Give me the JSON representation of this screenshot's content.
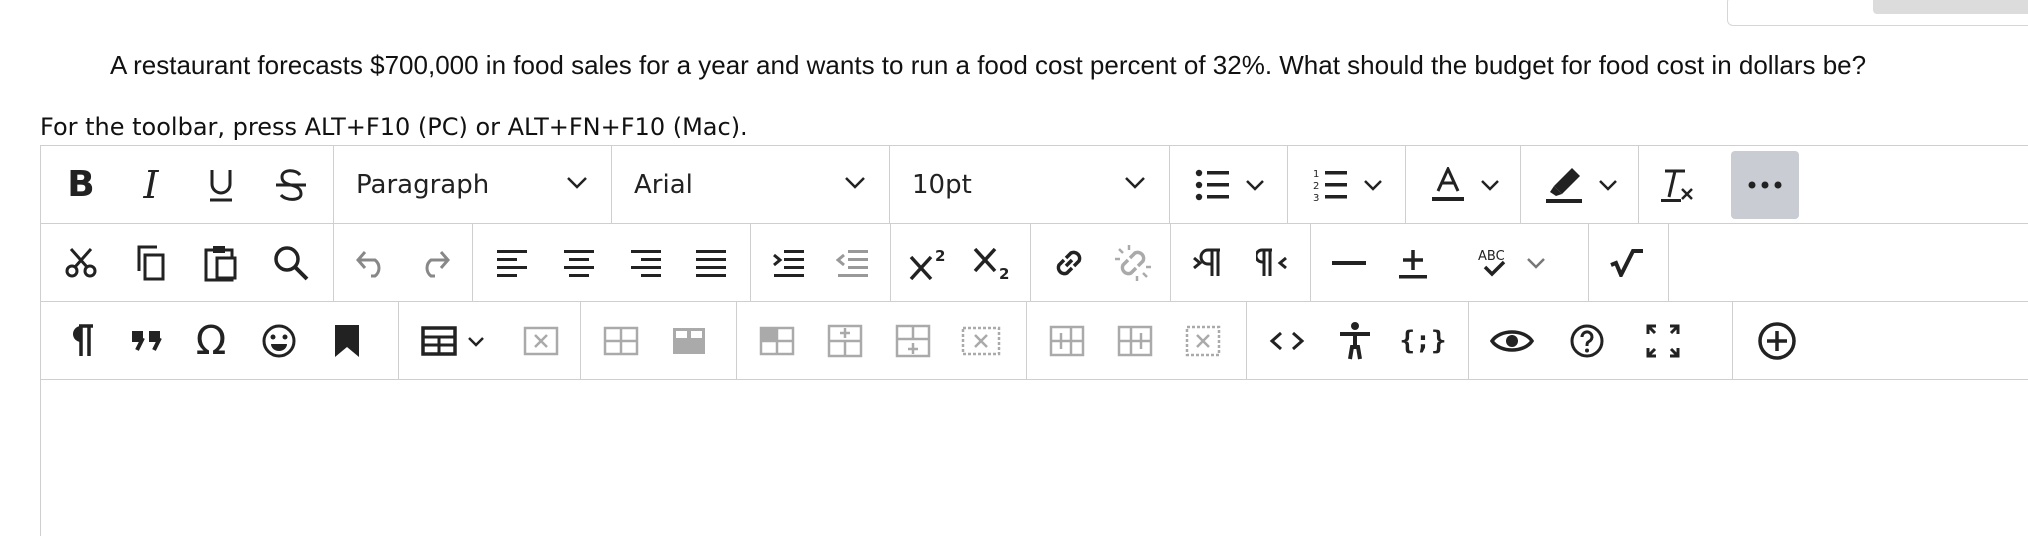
{
  "question": {
    "text": "A restaurant forecasts $700,000 in food sales for a year and wants to run a food cost percent of 32%. What should the budget for food cost in dollars be?"
  },
  "editor": {
    "hint": "For the toolbar, press ALT+F10 (PC) or ALT+FN+F10 (Mac).",
    "block_format": "Paragraph",
    "font_family": "Arial",
    "font_size": "10pt",
    "body_text": "",
    "toolbar": {
      "row1": [
        "bold-icon",
        "italic-icon",
        "underline-icon",
        "strikethrough-icon",
        "bullet-list-icon",
        "numbered-list-icon",
        "text-color-icon",
        "highlight-icon",
        "clear-formatting-icon",
        "more-icon"
      ],
      "row2": [
        "cut-icon",
        "copy-icon",
        "paste-icon",
        "find-icon",
        "undo-icon",
        "redo-icon",
        "align-left-icon",
        "align-center-icon",
        "align-right-icon",
        "justify-icon",
        "indent-icon",
        "outdent-icon",
        "superscript-icon",
        "subscript-icon",
        "link-icon",
        "unlink-icon",
        "ltr-icon",
        "rtl-icon",
        "horizontal-rule-icon",
        "plus-minus-icon",
        "spellcheck-icon",
        "math-icon"
      ],
      "row3": [
        "paragraph-mark-icon",
        "blockquote-icon",
        "omega-icon",
        "emoji-icon",
        "bookmark-icon",
        "table-icon",
        "delete-table-icon",
        "insert-row-before-icon",
        "insert-row-after-icon",
        "cell-properties-icon",
        "merge-cells-icon",
        "split-cells-icon",
        "delete-cells-icon",
        "insert-col-before-icon",
        "insert-col-after-icon",
        "delete-col-icon",
        "source-code-icon",
        "accessibility-icon",
        "code-sample-icon",
        "preview-icon",
        "help-icon",
        "fullscreen-icon",
        "add-content-icon"
      ]
    }
  }
}
